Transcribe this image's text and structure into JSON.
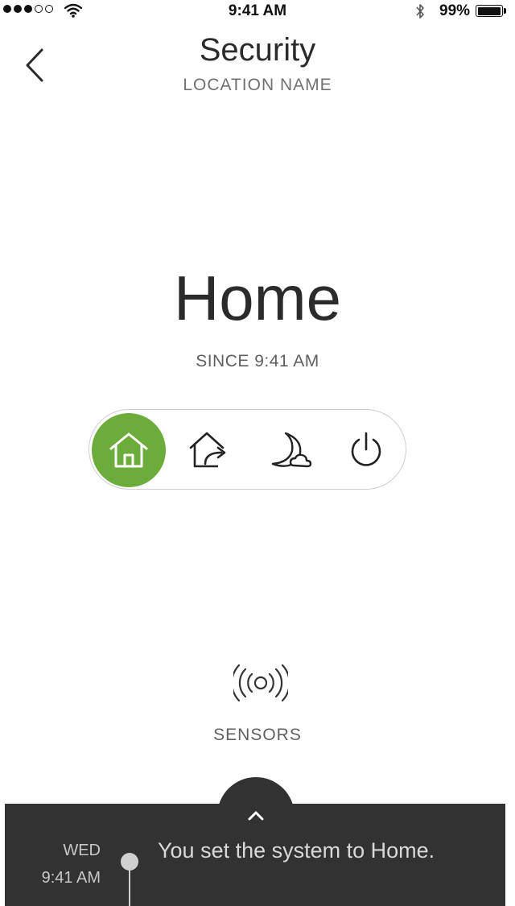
{
  "status_bar": {
    "time": "9:41 AM",
    "battery_percent": "99%",
    "battery_level": 0.99,
    "signal_bars": 3,
    "signal_total": 5,
    "icons": [
      "signal-dots-icon",
      "wifi-icon",
      "bluetooth-icon",
      "battery-icon"
    ]
  },
  "header": {
    "title": "Security",
    "location": "LOCATION NAME",
    "back_icon": "chevron-left-icon"
  },
  "mode": {
    "current": "Home",
    "since": "SINCE 9:41 AM",
    "accent_color": "#6cac3a",
    "options": [
      {
        "id": "home",
        "icon": "home-icon",
        "active": true
      },
      {
        "id": "away",
        "icon": "away-icon",
        "active": false
      },
      {
        "id": "night",
        "icon": "night-icon",
        "active": false
      },
      {
        "id": "off",
        "icon": "power-icon",
        "active": false
      }
    ]
  },
  "sensors": {
    "label": "SENSORS",
    "icon": "sensor-broadcast-icon"
  },
  "activity": {
    "day": "WED",
    "time": "9:41 AM",
    "message": "You set the system to Home.",
    "expand_icon": "chevron-up-icon",
    "drawer_color": "#323232"
  }
}
